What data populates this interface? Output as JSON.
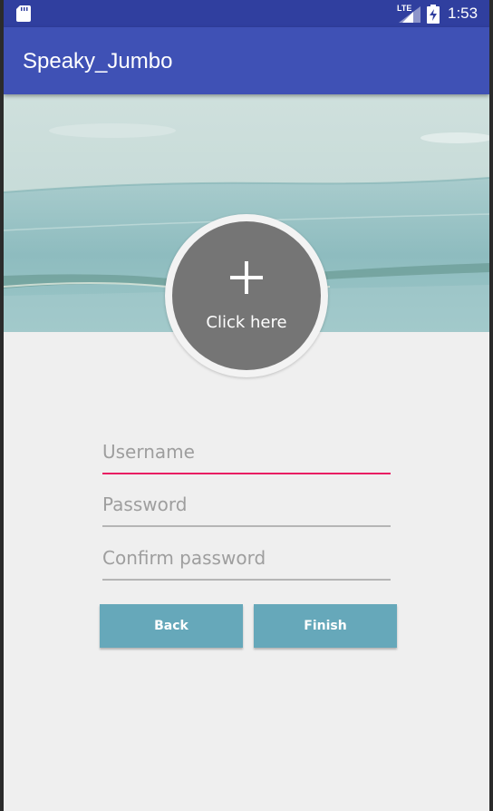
{
  "status_bar": {
    "network": "LTE",
    "time": "1:53",
    "icons": [
      "sd-card-icon",
      "signal-icon",
      "battery-charging-icon"
    ]
  },
  "app_bar": {
    "title": "Speaky_Jumbo"
  },
  "avatar": {
    "icon": "plus-icon",
    "label": "Click here"
  },
  "form": {
    "username_placeholder": "Username",
    "username_value": "",
    "password_placeholder": "Password",
    "password_value": "",
    "confirm_placeholder": "Confirm password",
    "confirm_value": ""
  },
  "buttons": {
    "back": "Back",
    "finish": "Finish"
  },
  "colors": {
    "status_bar": "#303f9f",
    "app_bar": "#3f51b5",
    "accent": "#e91e63",
    "button": "#66a8ba",
    "avatar": "#757575"
  }
}
